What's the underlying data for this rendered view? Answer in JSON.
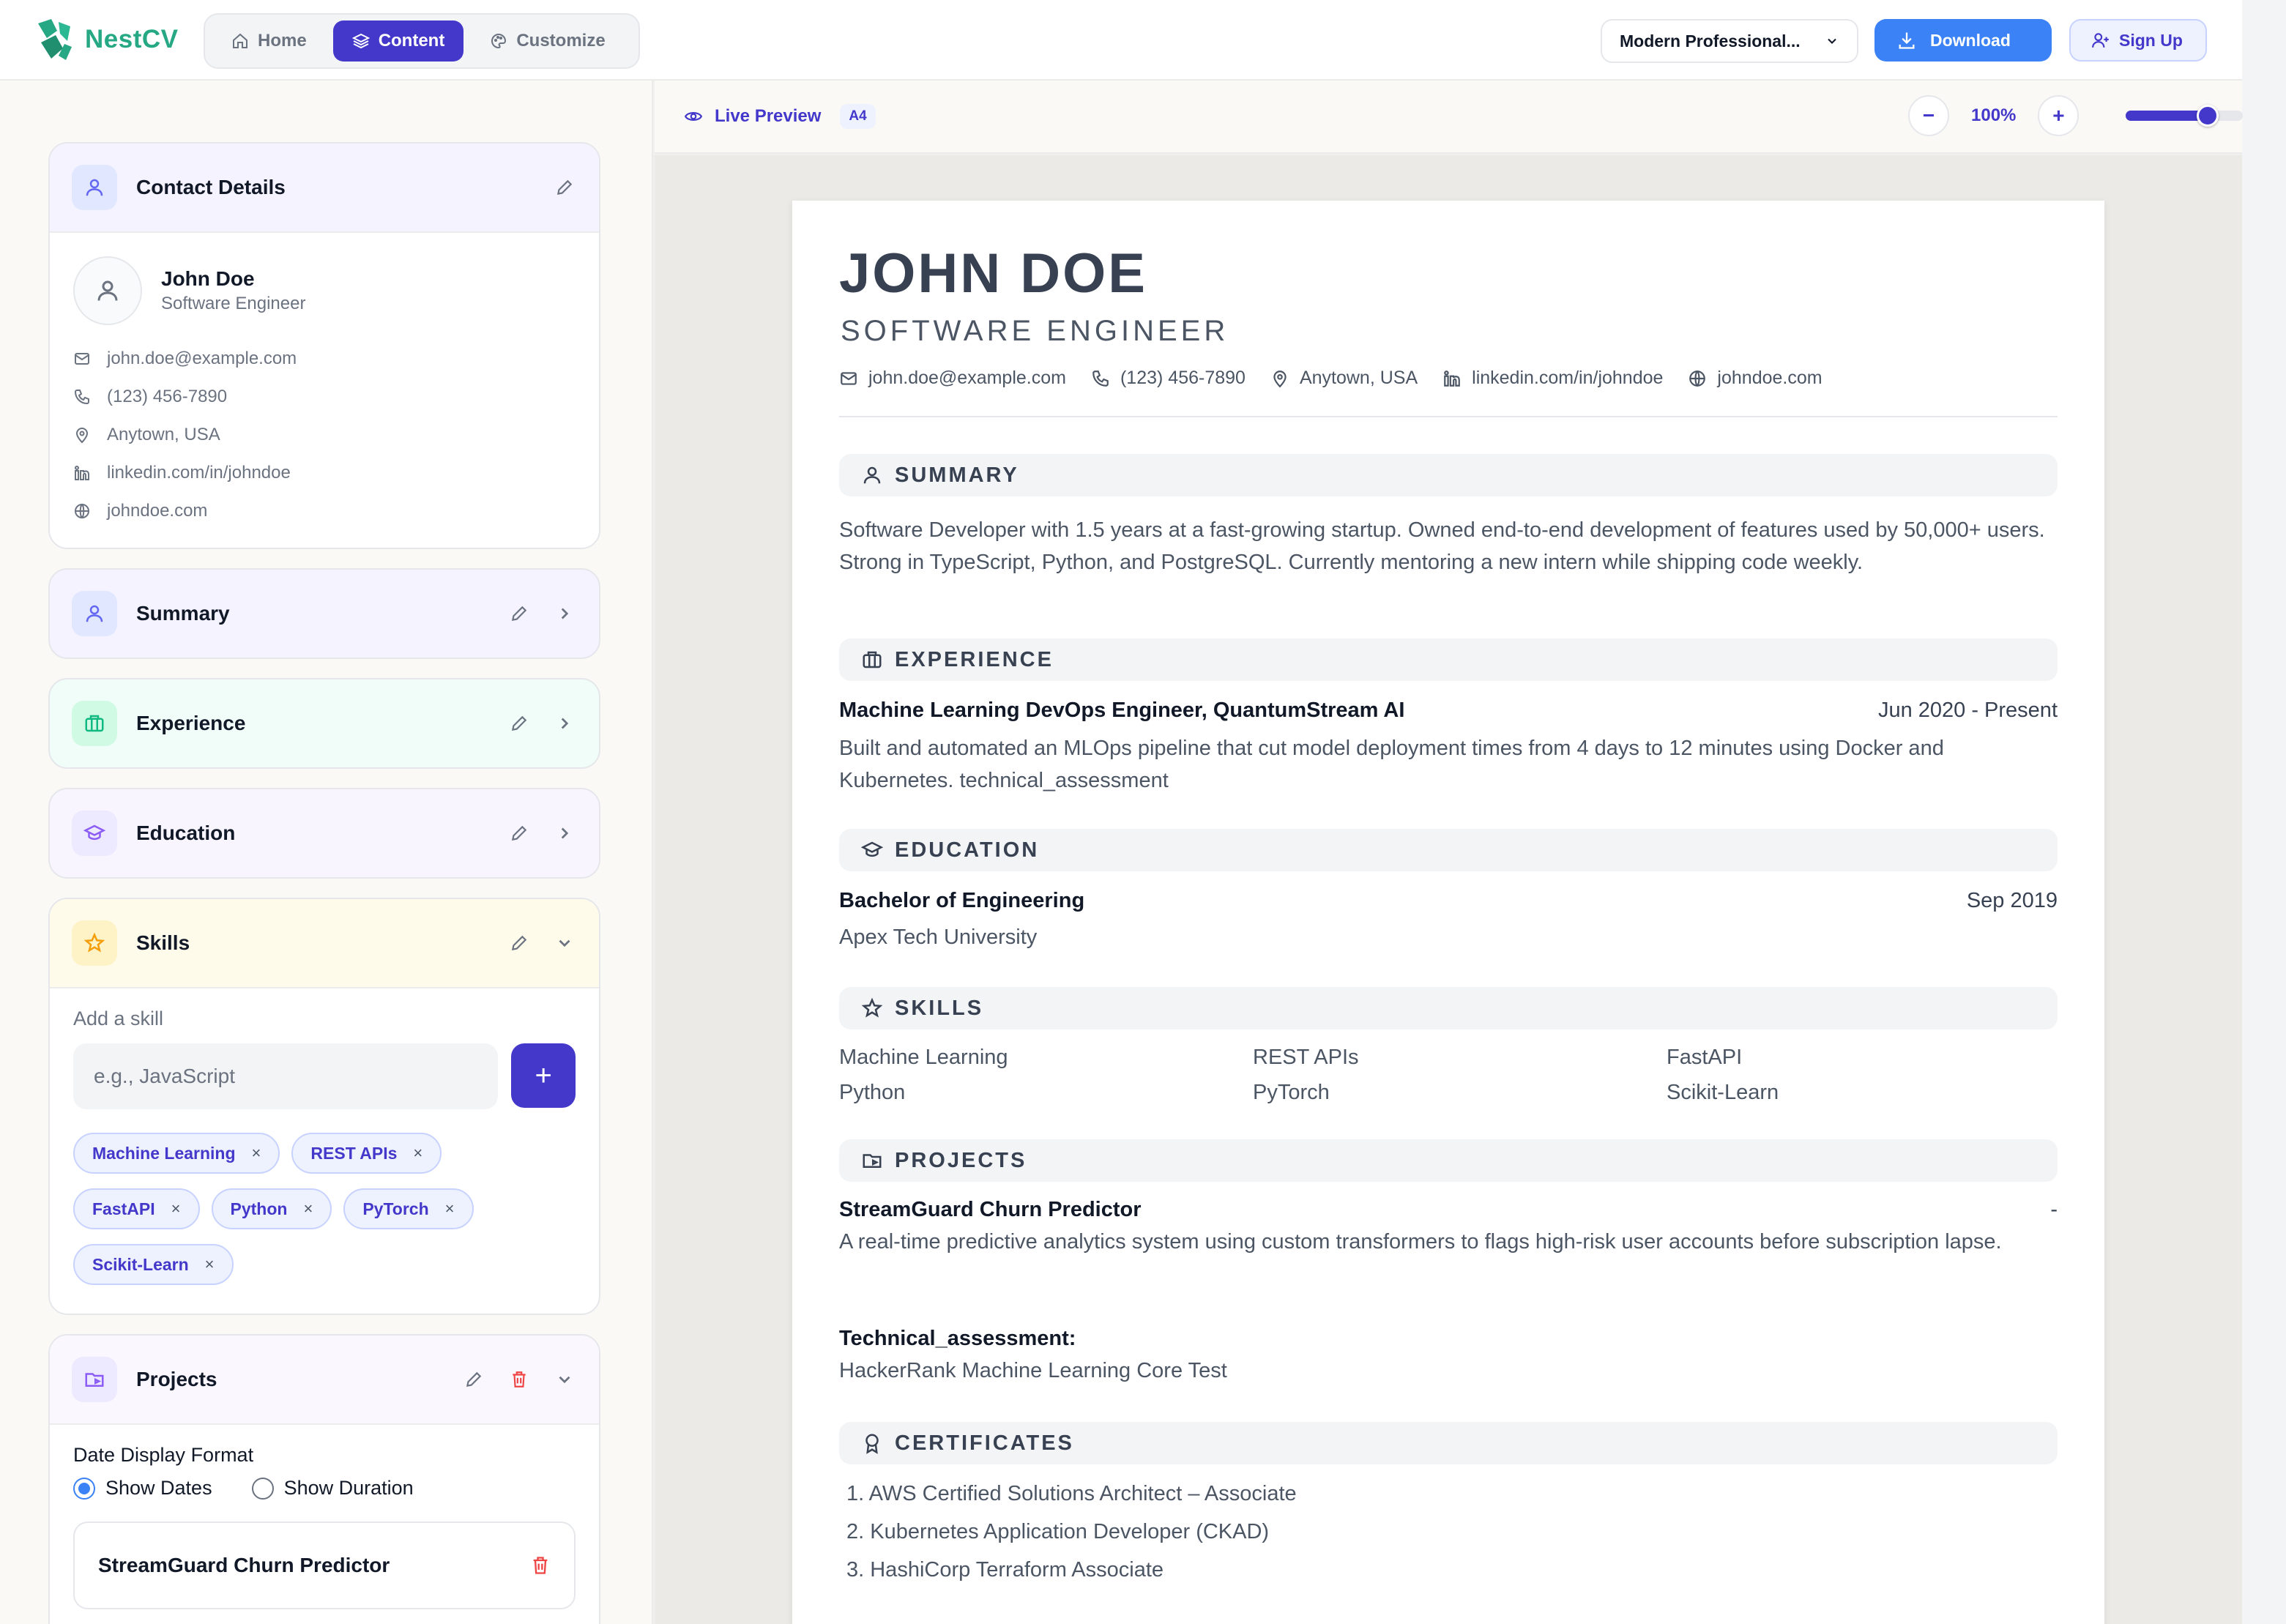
{
  "app": {
    "name": "NestCV"
  },
  "nav": {
    "home": "Home",
    "content": "Content",
    "customize": "Customize"
  },
  "toolbar": {
    "template": "Modern Professional...",
    "download": "Download",
    "signup": "Sign Up"
  },
  "preview": {
    "label": "Live Preview",
    "paper": "A4",
    "zoom": "100%",
    "zoom_minus": "−",
    "zoom_plus": "+",
    "zoom_fraction": 0.7
  },
  "contact": {
    "title": "Contact Details",
    "name": "John Doe",
    "role": "Software Engineer",
    "email": "john.doe@example.com",
    "phone": "(123) 456-7890",
    "location": "Anytown, USA",
    "linkedin": "linkedin.com/in/johndoe",
    "website": "johndoe.com"
  },
  "sections": {
    "summary": "Summary",
    "experience": "Experience",
    "education": "Education",
    "skills": "Skills",
    "projects": "Projects"
  },
  "skills_editor": {
    "label": "Add a skill",
    "placeholder": "e.g., JavaScript",
    "add": "+",
    "chips": [
      "Machine Learning",
      "REST APIs",
      "FastAPI",
      "Python",
      "PyTorch",
      "Scikit-Learn"
    ],
    "remove": "×"
  },
  "projects_editor": {
    "date_format_label": "Date Display Format",
    "show_dates": "Show Dates",
    "show_duration": "Show Duration",
    "selected": "Show Dates",
    "item": "StreamGuard Churn Predictor"
  },
  "resume": {
    "name": "JOHN DOE",
    "title": "SOFTWARE ENGINEER",
    "email": "john.doe@example.com",
    "phone": "(123) 456-7890",
    "location": "Anytown, USA",
    "linkedin": "linkedin.com/in/johndoe",
    "website": "johndoe.com",
    "summary_heading": "SUMMARY",
    "summary": "Software Developer with 1.5 years at a fast-growing startup. Owned end-to-end development of features used by 50,000+ users. Strong in TypeScript, Python, and PostgreSQL. Currently mentoring a new intern while shipping code weekly.",
    "experience_heading": "EXPERIENCE",
    "exp_role": "Machine Learning DevOps Engineer, QuantumStream AI",
    "exp_dates": "Jun 2020 - Present",
    "exp_desc": "Built and automated an MLOps pipeline that cut model deployment times from 4 days to 12 minutes using Docker and Kubernetes. technical_assessment",
    "education_heading": "EDUCATION",
    "edu_degree": "Bachelor of Engineering",
    "edu_date": "Sep 2019",
    "edu_school": "Apex Tech University",
    "skills_heading": "SKILLS",
    "skills": [
      "Machine Learning",
      "REST APIs",
      "FastAPI",
      "Python",
      "PyTorch",
      "Scikit-Learn"
    ],
    "projects_heading": "PROJECTS",
    "proj_name": "StreamGuard Churn Predictor",
    "proj_date": "-",
    "proj_desc": "A real-time predictive analytics system using custom transformers to flags high-risk user accounts before subscription lapse.",
    "proj_extra_label": "Technical_assessment:",
    "proj_extra_value": "HackerRank Machine Learning Core Test",
    "certificates_heading": "CERTIFICATES",
    "certificates": [
      "1.  AWS Certified Solutions Architect – Associate",
      "2.  Kubernetes Application Developer (CKAD)",
      "3.  HashiCorp Terraform Associate"
    ]
  },
  "colors": {
    "brand": "#26a884",
    "accent": "#4338ca",
    "download": "#3b82f6",
    "danger": "#ef4444"
  }
}
